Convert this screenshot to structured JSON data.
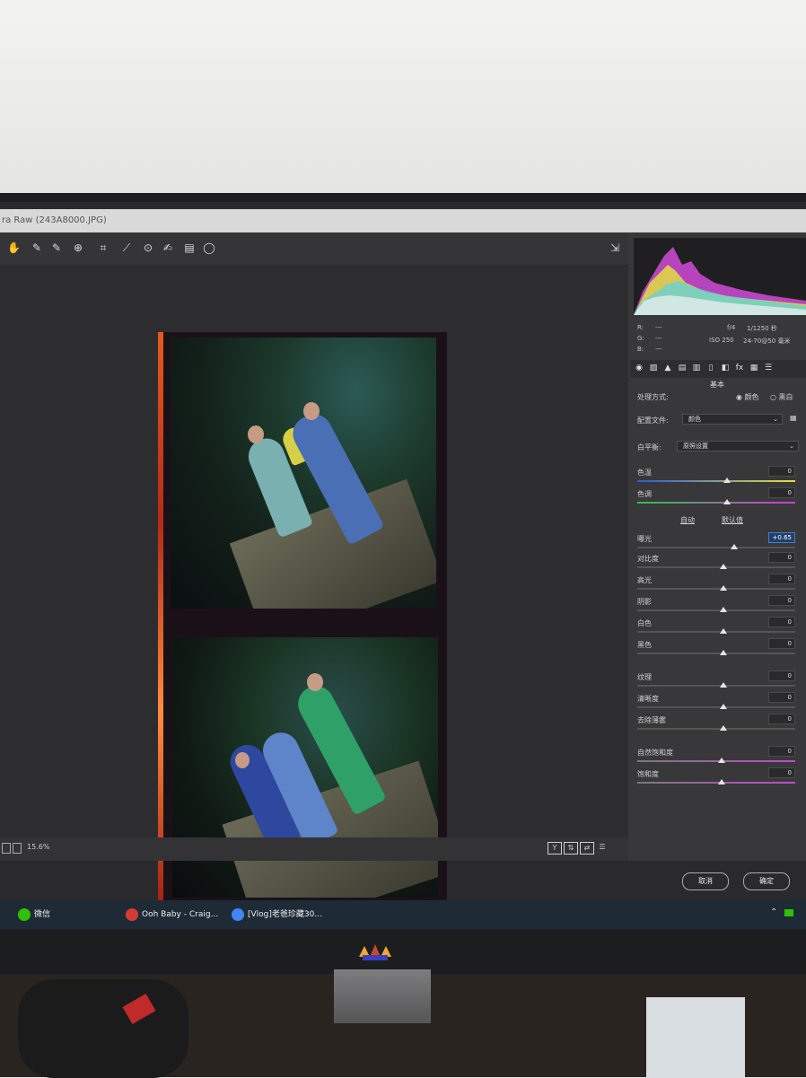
{
  "window": {
    "title": "ra Raw (243A8000.JPG)"
  },
  "toolbar": {
    "tools": [
      "hand-icon",
      "white-balance-icon",
      "color-sampler-icon",
      "target-adjust-icon",
      "crop-icon",
      "straighten-icon",
      "spot-removal-icon",
      "redeye-icon",
      "adjustment-brush-icon",
      "graduated-filter-icon"
    ],
    "export_icon": "open-export-icon"
  },
  "viewer": {
    "zoom": "15.6%"
  },
  "panel": {
    "meta": {
      "r_label": "R:",
      "g_label": "G:",
      "b_label": "B:",
      "r_value": "---",
      "g_value": "---",
      "b_value": "---",
      "aperture": "f/4",
      "shutter": "1/1250 秒",
      "iso": "ISO 250",
      "lens": "24-70@50 毫米"
    },
    "section_title": "基本",
    "treatment": {
      "label": "处理方式:",
      "color": "颜色",
      "bw": "黑白"
    },
    "profile": {
      "label": "配置文件:",
      "value": "颜色"
    },
    "white_balance": {
      "label": "白平衡:",
      "value": "原照设置"
    },
    "auto": "自动",
    "default": "默认值",
    "sliders": [
      {
        "label": "色温",
        "value": "0"
      },
      {
        "label": "色调",
        "value": "0"
      },
      {
        "label": "曝光",
        "value": "+0.65"
      },
      {
        "label": "对比度",
        "value": "0"
      },
      {
        "label": "高光",
        "value": "0"
      },
      {
        "label": "阴影",
        "value": "0"
      },
      {
        "label": "白色",
        "value": "0"
      },
      {
        "label": "黑色",
        "value": "0"
      },
      {
        "label": "纹理",
        "value": "0"
      },
      {
        "label": "清晰度",
        "value": "0"
      },
      {
        "label": "去除薄雾",
        "value": "0"
      },
      {
        "label": "自然饱和度",
        "value": "0"
      },
      {
        "label": "饱和度",
        "value": "0"
      }
    ]
  },
  "buttons": {
    "cancel": "取消",
    "ok": "确定"
  },
  "taskbar": {
    "items": [
      {
        "label": "微信",
        "color": "#2dc100"
      },
      {
        "label": "Ooh Baby - Craig...",
        "color": "#d43c33"
      },
      {
        "label": "[Vlog]老爸珍藏30...",
        "color": "#4285f4"
      }
    ]
  }
}
